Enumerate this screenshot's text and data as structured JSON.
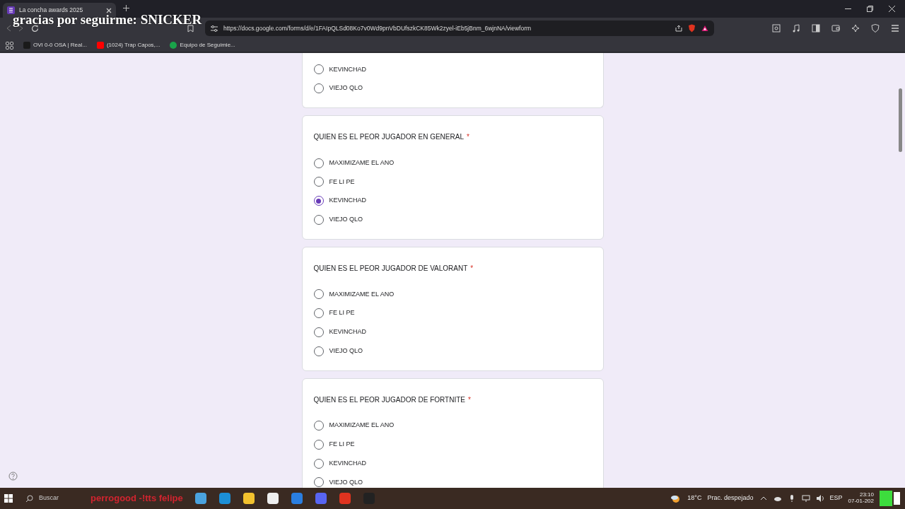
{
  "browser": {
    "tab_title": "La concha awards 2025",
    "url": "https://docs.google.com/forms/d/e/1FAIpQLSd08Ko7v0Wd9pnVbDUfszkCK85Wk2zyel-iEb5jBnm_6wjnNA/viewform",
    "bookmarks": [
      {
        "label": "OVI 0-0 OSA | Real...",
        "color": "#1a1a1a"
      },
      {
        "label": "(1024) Trap Capos,...",
        "color": "#ff0000"
      },
      {
        "label": "Equipo de Seguimie...",
        "color": "#1aa34a"
      }
    ]
  },
  "overlay_text": "gracias por seguirme: SNICKER",
  "partial_card": {
    "options": [
      {
        "label": "KEVINCHAD",
        "selected": false
      },
      {
        "label": "VIEJO QLO",
        "selected": false
      }
    ]
  },
  "questions": [
    {
      "title": "QUIEN ES EL PEOR JUGADOR EN GENERAL",
      "required": true,
      "required_mark": "*",
      "options": [
        {
          "label": "MAXIMIZAME EL ANO",
          "selected": false
        },
        {
          "label": "FE LI PE",
          "selected": false
        },
        {
          "label": "KEVINCHAD",
          "selected": true
        },
        {
          "label": "VIEJO QLO",
          "selected": false
        }
      ]
    },
    {
      "title": "QUIEN ES EL PEOR JUGADOR DE VALORANT",
      "required": true,
      "required_mark": "*",
      "options": [
        {
          "label": "MAXIMIZAME EL ANO",
          "selected": false
        },
        {
          "label": "FE LI PE",
          "selected": false
        },
        {
          "label": "KEVINCHAD",
          "selected": false
        },
        {
          "label": "VIEJO QLO",
          "selected": false
        }
      ]
    },
    {
      "title": "QUIEN ES EL PEOR JUGADOR DE FORTNITE",
      "required": true,
      "required_mark": "*",
      "options": [
        {
          "label": "MAXIMIZAME EL ANO",
          "selected": false
        },
        {
          "label": "FE LI PE",
          "selected": false
        },
        {
          "label": "KEVINCHAD",
          "selected": false
        },
        {
          "label": "VIEJO QLO",
          "selected": false
        }
      ]
    }
  ],
  "taskbar": {
    "search_placeholder": "Buscar",
    "overlay_text": "perrogood -!tts felipe",
    "temperature": "18°C",
    "weather": "Prac. despejado",
    "language": "ESP",
    "time": "23:10",
    "date": "07-01-202"
  }
}
